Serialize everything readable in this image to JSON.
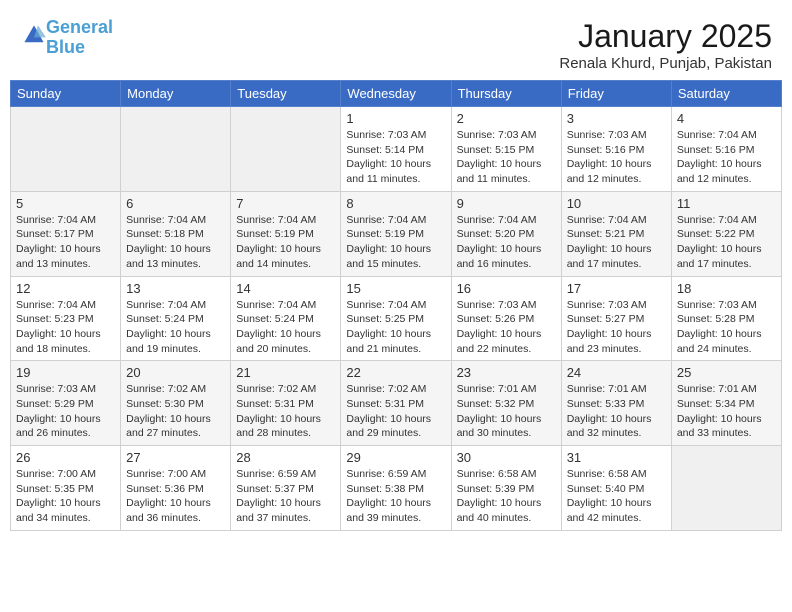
{
  "logo": {
    "line1": "General",
    "line2": "Blue"
  },
  "title": "January 2025",
  "subtitle": "Renala Khurd, Punjab, Pakistan",
  "weekdays": [
    "Sunday",
    "Monday",
    "Tuesday",
    "Wednesday",
    "Thursday",
    "Friday",
    "Saturday"
  ],
  "weeks": [
    [
      {
        "day": "",
        "info": ""
      },
      {
        "day": "",
        "info": ""
      },
      {
        "day": "",
        "info": ""
      },
      {
        "day": "1",
        "info": "Sunrise: 7:03 AM\nSunset: 5:14 PM\nDaylight: 10 hours\nand 11 minutes."
      },
      {
        "day": "2",
        "info": "Sunrise: 7:03 AM\nSunset: 5:15 PM\nDaylight: 10 hours\nand 11 minutes."
      },
      {
        "day": "3",
        "info": "Sunrise: 7:03 AM\nSunset: 5:16 PM\nDaylight: 10 hours\nand 12 minutes."
      },
      {
        "day": "4",
        "info": "Sunrise: 7:04 AM\nSunset: 5:16 PM\nDaylight: 10 hours\nand 12 minutes."
      }
    ],
    [
      {
        "day": "5",
        "info": "Sunrise: 7:04 AM\nSunset: 5:17 PM\nDaylight: 10 hours\nand 13 minutes."
      },
      {
        "day": "6",
        "info": "Sunrise: 7:04 AM\nSunset: 5:18 PM\nDaylight: 10 hours\nand 13 minutes."
      },
      {
        "day": "7",
        "info": "Sunrise: 7:04 AM\nSunset: 5:19 PM\nDaylight: 10 hours\nand 14 minutes."
      },
      {
        "day": "8",
        "info": "Sunrise: 7:04 AM\nSunset: 5:19 PM\nDaylight: 10 hours\nand 15 minutes."
      },
      {
        "day": "9",
        "info": "Sunrise: 7:04 AM\nSunset: 5:20 PM\nDaylight: 10 hours\nand 16 minutes."
      },
      {
        "day": "10",
        "info": "Sunrise: 7:04 AM\nSunset: 5:21 PM\nDaylight: 10 hours\nand 17 minutes."
      },
      {
        "day": "11",
        "info": "Sunrise: 7:04 AM\nSunset: 5:22 PM\nDaylight: 10 hours\nand 17 minutes."
      }
    ],
    [
      {
        "day": "12",
        "info": "Sunrise: 7:04 AM\nSunset: 5:23 PM\nDaylight: 10 hours\nand 18 minutes."
      },
      {
        "day": "13",
        "info": "Sunrise: 7:04 AM\nSunset: 5:24 PM\nDaylight: 10 hours\nand 19 minutes."
      },
      {
        "day": "14",
        "info": "Sunrise: 7:04 AM\nSunset: 5:24 PM\nDaylight: 10 hours\nand 20 minutes."
      },
      {
        "day": "15",
        "info": "Sunrise: 7:04 AM\nSunset: 5:25 PM\nDaylight: 10 hours\nand 21 minutes."
      },
      {
        "day": "16",
        "info": "Sunrise: 7:03 AM\nSunset: 5:26 PM\nDaylight: 10 hours\nand 22 minutes."
      },
      {
        "day": "17",
        "info": "Sunrise: 7:03 AM\nSunset: 5:27 PM\nDaylight: 10 hours\nand 23 minutes."
      },
      {
        "day": "18",
        "info": "Sunrise: 7:03 AM\nSunset: 5:28 PM\nDaylight: 10 hours\nand 24 minutes."
      }
    ],
    [
      {
        "day": "19",
        "info": "Sunrise: 7:03 AM\nSunset: 5:29 PM\nDaylight: 10 hours\nand 26 minutes."
      },
      {
        "day": "20",
        "info": "Sunrise: 7:02 AM\nSunset: 5:30 PM\nDaylight: 10 hours\nand 27 minutes."
      },
      {
        "day": "21",
        "info": "Sunrise: 7:02 AM\nSunset: 5:31 PM\nDaylight: 10 hours\nand 28 minutes."
      },
      {
        "day": "22",
        "info": "Sunrise: 7:02 AM\nSunset: 5:31 PM\nDaylight: 10 hours\nand 29 minutes."
      },
      {
        "day": "23",
        "info": "Sunrise: 7:01 AM\nSunset: 5:32 PM\nDaylight: 10 hours\nand 30 minutes."
      },
      {
        "day": "24",
        "info": "Sunrise: 7:01 AM\nSunset: 5:33 PM\nDaylight: 10 hours\nand 32 minutes."
      },
      {
        "day": "25",
        "info": "Sunrise: 7:01 AM\nSunset: 5:34 PM\nDaylight: 10 hours\nand 33 minutes."
      }
    ],
    [
      {
        "day": "26",
        "info": "Sunrise: 7:00 AM\nSunset: 5:35 PM\nDaylight: 10 hours\nand 34 minutes."
      },
      {
        "day": "27",
        "info": "Sunrise: 7:00 AM\nSunset: 5:36 PM\nDaylight: 10 hours\nand 36 minutes."
      },
      {
        "day": "28",
        "info": "Sunrise: 6:59 AM\nSunset: 5:37 PM\nDaylight: 10 hours\nand 37 minutes."
      },
      {
        "day": "29",
        "info": "Sunrise: 6:59 AM\nSunset: 5:38 PM\nDaylight: 10 hours\nand 39 minutes."
      },
      {
        "day": "30",
        "info": "Sunrise: 6:58 AM\nSunset: 5:39 PM\nDaylight: 10 hours\nand 40 minutes."
      },
      {
        "day": "31",
        "info": "Sunrise: 6:58 AM\nSunset: 5:40 PM\nDaylight: 10 hours\nand 42 minutes."
      },
      {
        "day": "",
        "info": ""
      }
    ]
  ]
}
